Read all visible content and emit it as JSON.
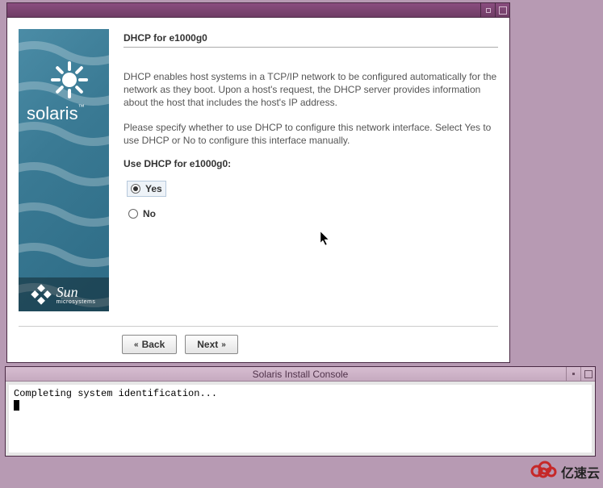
{
  "sidebar": {
    "brand": "solaris",
    "brand_tm": "™",
    "vendor_big": "Sun",
    "vendor_small": "microsystems"
  },
  "main": {
    "title": "DHCP for e1000g0",
    "para1": "DHCP enables host systems in a TCP/IP network to be configured automatically for the network as they boot. Upon a host's request, the DHCP server provides information about the host that includes the host's IP address.",
    "para2": "Please specify whether to use DHCP to configure this network interface. Select Yes to use DHCP or No to configure this interface manually.",
    "question": "Use DHCP for e1000g0:",
    "options": {
      "yes": "Yes",
      "no": "No"
    },
    "selected": "yes"
  },
  "footer": {
    "back": "Back",
    "next": "Next"
  },
  "console": {
    "title": "Solaris Install Console",
    "line1": "Completing system identification..."
  },
  "watermark": {
    "text": "亿速云"
  }
}
